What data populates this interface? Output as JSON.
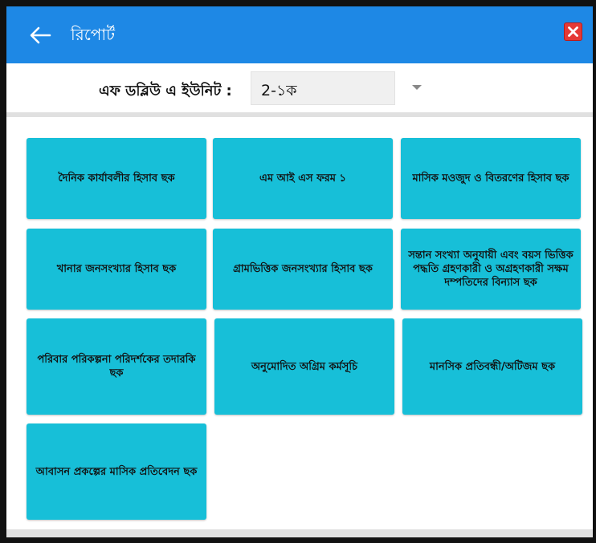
{
  "header": {
    "title": "রিপোর্ট",
    "back_icon": "arrow-left-icon",
    "close_icon": "close-icon",
    "bar_color": "#1e88e5",
    "close_color": "#e53935"
  },
  "filter": {
    "label": "এফ ডব্লিউ এ ইউনিট :",
    "selected_value": "2-১ক"
  },
  "tiles": [
    {
      "label": "দৈনিক কার্যাবলীর হিসাব ছক"
    },
    {
      "label": "এম আই এস ফরম ১"
    },
    {
      "label": "মাসিক মওজুদ ও বিতরণের হিসাব ছক"
    },
    {
      "label": "খানার জনসংখ্যার হিসাব ছক"
    },
    {
      "label": "গ্রামভিত্তিক জনসংখ্যার হিসাব ছক"
    },
    {
      "label": "সন্তান সংখ্যা অনুযায়ী এবং বয়স ভিত্তিক পদ্ধতি গ্রহণকারী ও অগ্রহণকারী সক্ষম দম্পতিদের বিন্যাস ছক"
    },
    {
      "label": "পরিবার পরিকল্পনা পরিদর্শকের তদারকি ছক"
    },
    {
      "label": "অনুমোদিত অগ্রিম কর্মসূচি"
    },
    {
      "label": "মানসিক প্রতিবন্ধী/অটিজম ছক"
    },
    {
      "label": "আবাসন প্রকল্পের মাসিক প্রতিবেদন ছক"
    }
  ],
  "tile_color": "#17bfd8"
}
